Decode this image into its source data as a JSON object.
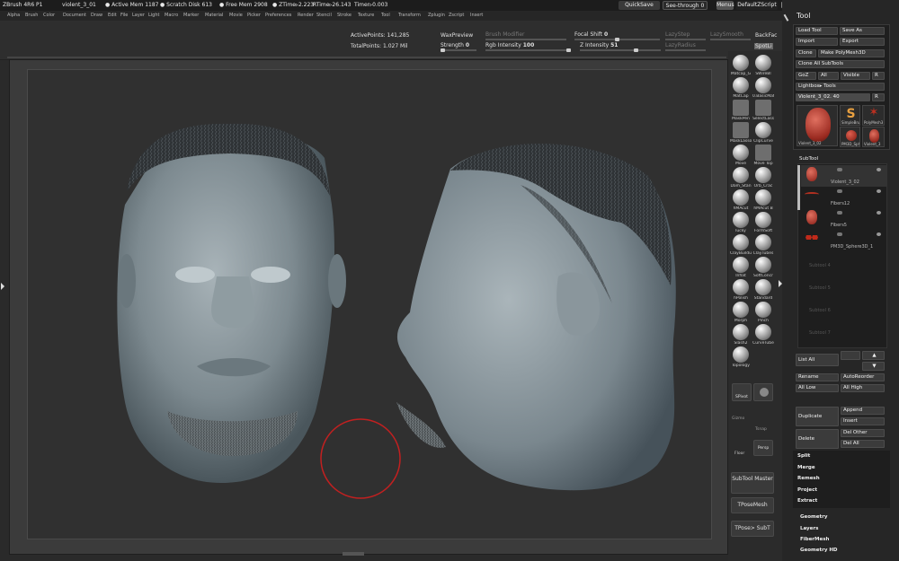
{
  "title_bar": {
    "app_name": "ZBrush 4R6 P1",
    "doc_name": "violent_3_01",
    "active_mem": "● Active Mem 1187",
    "scratch_disk": "● Scratch Disk 613",
    "free_mem": "● Free Mem 2908",
    "ztime": "● ZTime▹2.223",
    "rtime": "RTime▹26.143",
    "timer": "Timer▹0.003",
    "quicksave": "QuickSave",
    "see_through": "See-through  0",
    "menus_btn": "Menus",
    "script": "DefaultZScript"
  },
  "menubar": [
    "Alpha",
    "Brush",
    "Color",
    "Document",
    "Draw",
    "Edit",
    "File",
    "Layer",
    "Light",
    "Macro",
    "Marker",
    "Material",
    "Movie",
    "Picker",
    "Preferences",
    "Render",
    "Stencil",
    "Stroke",
    "Texture",
    "Tool",
    "Transform",
    "Zplugin",
    "Zscript",
    "Insert"
  ],
  "top_info": {
    "active_points": "ActivePoints: 141,285",
    "total_points": "TotalPoints: 1.027 Mil",
    "wax_preview": "WaxPreview",
    "brush_modifier": "Brush Modifier",
    "strength_label": "Strength",
    "strength_value": "0",
    "rgb_label": "Rgb Intensity",
    "rgb_value": "100",
    "focal_label": "Focal Shift",
    "focal_value": "0",
    "z_label": "Z Intensity",
    "z_value": "51",
    "lazystep": "LazyStep",
    "lazysmooth": "LazySmooth",
    "lazyradius": "LazyRadius",
    "backface": "BackFac",
    "spotlight": "SpotLi"
  },
  "brushes": [
    {
      "label": "Matcap_G",
      "shape": "ball"
    },
    {
      "label": "SWireBl",
      "shape": "ball"
    },
    {
      "label": "MatCap",
      "shape": "ball"
    },
    {
      "label": "0.BasicMate",
      "shape": "ball"
    },
    {
      "label": "MaskPen",
      "shape": "sq"
    },
    {
      "label": "SelectLass",
      "shape": "sq"
    },
    {
      "label": "MaskLasso",
      "shape": "sq"
    },
    {
      "label": "ClipCurve",
      "shape": "ball"
    },
    {
      "label": "Move",
      "shape": "ball"
    },
    {
      "label": "Move Top",
      "shape": "sq"
    },
    {
      "label": "Dam_Stan",
      "shape": "ball"
    },
    {
      "label": "Orb_Crac",
      "shape": "ball"
    },
    {
      "label": "hMAcut",
      "shape": "ball"
    },
    {
      "label": "hMAcut B",
      "shape": "ball"
    },
    {
      "label": "lucky",
      "shape": "ball"
    },
    {
      "label": "FormSoft",
      "shape": "ball"
    },
    {
      "label": "ClayBuildu",
      "shape": "ball"
    },
    {
      "label": "ClayTubes",
      "shape": "ball"
    },
    {
      "label": "Inflat",
      "shape": "ball"
    },
    {
      "label": "SoftConcr",
      "shape": "ball"
    },
    {
      "label": "hPolish",
      "shape": "ball"
    },
    {
      "label": "Standard",
      "shape": "ball"
    },
    {
      "label": "Morph",
      "shape": "ball"
    },
    {
      "label": "Pinch",
      "shape": "ball"
    },
    {
      "label": "Slash2",
      "shape": "ball"
    },
    {
      "label": "CurveTube",
      "shape": "ball"
    },
    {
      "label": "Topology",
      "shape": "ball"
    }
  ],
  "brush_extra": {
    "spivot": "SPivot",
    "smooth_lbl": "Smooth",
    "gizmo": "Gizmo",
    "tsnap": "Tsnap",
    "floor": "Floor",
    "persp": "Persp",
    "subtool_master": "SubTool Master",
    "tposemesh": "TPoseMesh",
    "tposesubt": "TPose> SubT"
  },
  "tool_panel": {
    "title": "Tool",
    "load_tool": "Load Tool",
    "save_as": "Save As",
    "import": "Import",
    "export": "Export",
    "clone": "Clone",
    "make_polymesh": "Make PolyMesh3D",
    "clone_all": "Clone All SubTools",
    "goz": "GoZ",
    "all": "All",
    "visible": "Visible",
    "r": "R",
    "lightbox_tools": "Lightbox▸ Tools",
    "current_tool": "Violent_3_02. 40",
    "thumbs": [
      {
        "label": "Violent_3_02",
        "kind": "head"
      },
      {
        "label": "SimpleBru",
        "kind": "s"
      },
      {
        "label": "PolyMesh3",
        "kind": "star"
      },
      {
        "label": "PM3D_Sph",
        "kind": "sphere"
      },
      {
        "label": "Violent_3",
        "kind": "head"
      }
    ]
  },
  "subtool": {
    "title": "SubTool",
    "items": [
      {
        "name": "Violent_3_02",
        "kind": "head"
      },
      {
        "name": "Fibers12",
        "kind": "brows"
      },
      {
        "name": "Fibers5",
        "kind": "head"
      },
      {
        "name": "PM3D_Sphere3D_1",
        "kind": "eyes"
      }
    ],
    "empty_slots": [
      "Subtool 4",
      "Subtool 5",
      "Subtool 6",
      "Subtool 7"
    ],
    "list_all": "List All",
    "rename": "Rename",
    "auto_reorder": "AutoReorder",
    "all_low": "All Low",
    "all_high": "All High",
    "duplicate": "Duplicate",
    "append": "Append",
    "insert": "Insert",
    "delete": "Delete",
    "del_other": "Del Other",
    "del_all": "Del All",
    "split": "Split",
    "merge": "Merge",
    "remesh": "Remesh",
    "project": "Project",
    "extract": "Extract"
  },
  "palette_sections": [
    "Geometry",
    "Layers",
    "FiberMesh",
    "Geometry HD"
  ],
  "colors": {
    "draw_circle": "#c22020",
    "accent": "#e8a040"
  }
}
